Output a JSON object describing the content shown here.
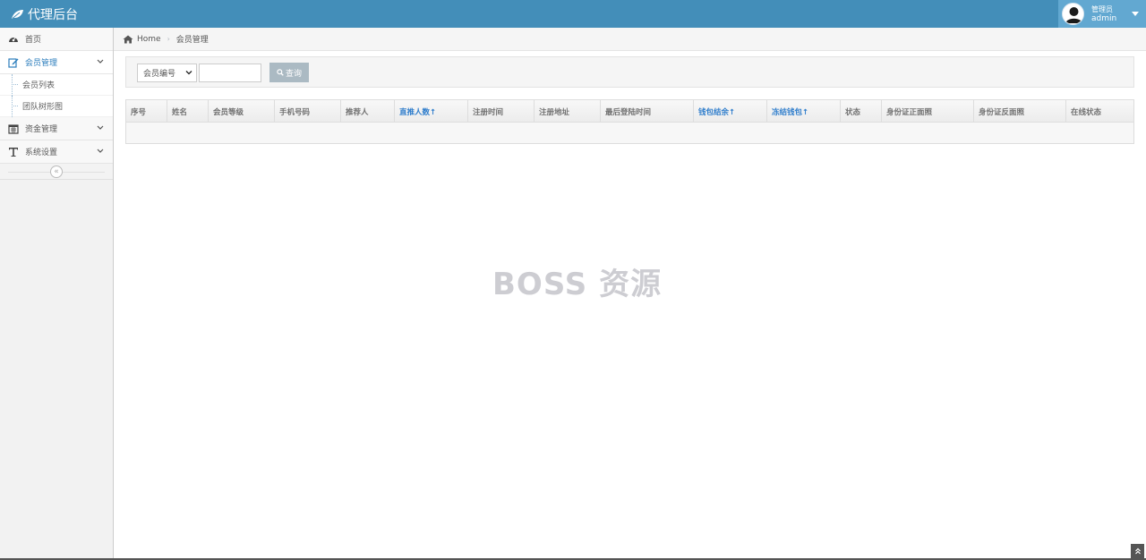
{
  "navbar": {
    "brand": "代理后台",
    "user_role": "管理员",
    "user_name": "admin"
  },
  "sidebar": {
    "items": [
      {
        "label": "首页",
        "icon": "tachometer-icon"
      },
      {
        "label": "会员管理",
        "icon": "edit-icon",
        "active": true,
        "children": [
          {
            "label": "会员列表"
          },
          {
            "label": "团队树形图"
          }
        ]
      },
      {
        "label": "资金管理",
        "icon": "calendar-icon"
      },
      {
        "label": "系统设置",
        "icon": "text-icon"
      }
    ],
    "collapse_glyph": "«"
  },
  "breadcrumb": {
    "home": "Home",
    "current": "会员管理"
  },
  "search": {
    "select_value": "会员编号",
    "input_value": "",
    "query_label": "查询"
  },
  "table": {
    "columns": [
      {
        "label": "序号",
        "sortable": false
      },
      {
        "label": "姓名",
        "sortable": false
      },
      {
        "label": "会员等级",
        "sortable": false
      },
      {
        "label": "手机号码",
        "sortable": false
      },
      {
        "label": "推荐人",
        "sortable": false
      },
      {
        "label": "直推人数↑",
        "sortable": true
      },
      {
        "label": "注册时间",
        "sortable": false
      },
      {
        "label": "注册地址",
        "sortable": false
      },
      {
        "label": "最后登陆时间",
        "sortable": false
      },
      {
        "label": "钱包结余↑",
        "sortable": true
      },
      {
        "label": "冻结钱包↑",
        "sortable": true
      },
      {
        "label": "状态",
        "sortable": false
      },
      {
        "label": "身份证正面照",
        "sortable": false
      },
      {
        "label": "身份证反面照",
        "sortable": false
      },
      {
        "label": "在线状态",
        "sortable": false
      }
    ],
    "rows": []
  },
  "watermark": "BOSS 资源",
  "colors": {
    "navbar": "#438eb9",
    "user_box": "#62a8d1",
    "active_text": "#2b7dbc",
    "sortable_header": "#307ecc",
    "query_button": "#abbac3"
  }
}
